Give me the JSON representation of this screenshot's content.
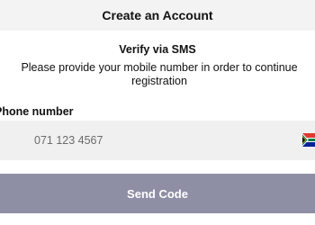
{
  "header": {
    "title": "Create an Account"
  },
  "verify": {
    "title": "Verify via SMS",
    "description": "Please provide your mobile number in order to continue registration"
  },
  "phone": {
    "label": "Phone number",
    "placeholder": "071 123 4567",
    "value": "",
    "country_icon": "south-africa-flag-icon"
  },
  "actions": {
    "send_label": "Send Code"
  },
  "colors": {
    "header_bg": "#f3f3f4",
    "field_bg": "#f0f0f1",
    "button_bg": "#8e8fa5",
    "button_text": "#ffffff"
  }
}
